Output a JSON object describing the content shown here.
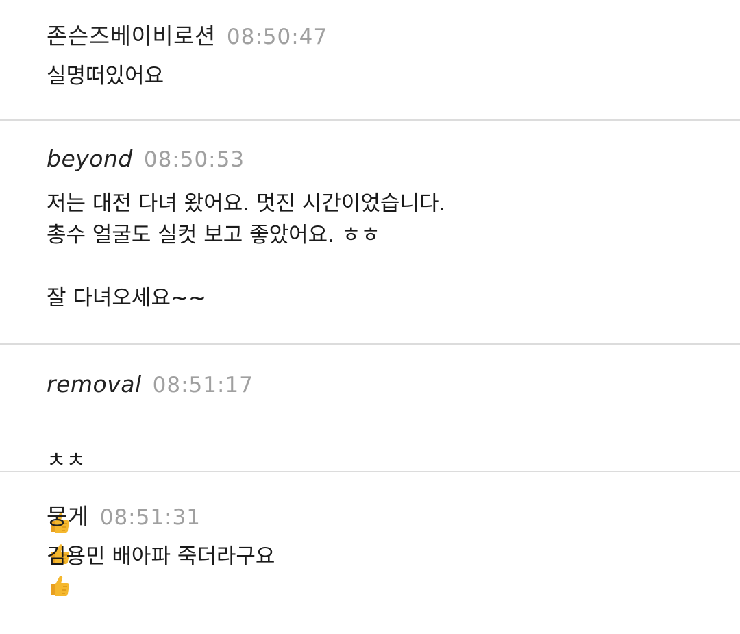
{
  "comments": [
    {
      "author": "존슨즈베이비로션",
      "time": "08:50:47",
      "text": "실명떠있어요"
    },
    {
      "author": "beyond",
      "time": "08:50:53",
      "text": "저는 대전 다녀 왔어요. 멋진 시간이었습니다.\n총수 얼굴도 실컷 보고 좋았어요. ㅎㅎ\n\n잘 다녀오세요~~"
    },
    {
      "author": "removal",
      "time": "08:51:17",
      "text": "ㅊㅊ",
      "emojis": [
        "thumbs-up-icon",
        "thumbs-up-icon",
        "thumbs-up-icon"
      ]
    },
    {
      "author": "뭉게",
      "time": "08:51:31",
      "text": "김용민 배아파 죽더라구요"
    }
  ],
  "colors": {
    "divider": "#dcdcdc",
    "timestamp": "#a0a0a0",
    "text": "#1a1a1a",
    "emoji": "#f5b82e"
  }
}
